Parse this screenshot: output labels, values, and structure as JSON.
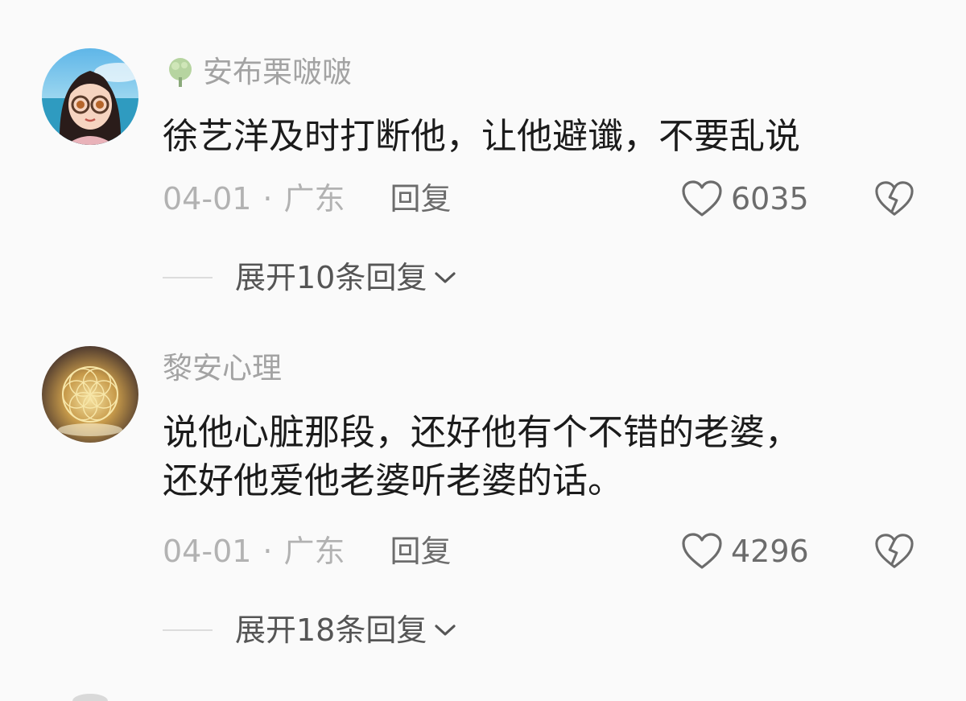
{
  "comments": [
    {
      "username": "安布栗啵啵",
      "avatar_icon": "girl-with-glasses-avatar",
      "badge_icon": "green-tree-badge-icon",
      "text_lines": [
        "徐艺洋及时打断他，让他避谶，不要乱说"
      ],
      "date": "04-01",
      "separator": "·",
      "location": "广东",
      "reply_label": "回复",
      "like_count": "6035",
      "expand_label": "展开10条回复"
    },
    {
      "username": "黎安心理",
      "avatar_icon": "golden-mandala-avatar",
      "text_lines": [
        "说他心脏那段，还好他有个不错的老婆，",
        "还好他爱他老婆听老婆的话。"
      ],
      "date": "04-01",
      "separator": "·",
      "location": "广东",
      "reply_label": "回复",
      "like_count": "4296",
      "expand_label": "展开18条回复"
    }
  ],
  "icons": {
    "like": "heart-outline-icon",
    "dislike": "broken-heart-icon",
    "expand": "chevron-down-icon"
  },
  "colors": {
    "background": "#fafafa",
    "text": "#1b1b1b",
    "muted": "#b2b2b2",
    "action": "#6c6c6c"
  }
}
